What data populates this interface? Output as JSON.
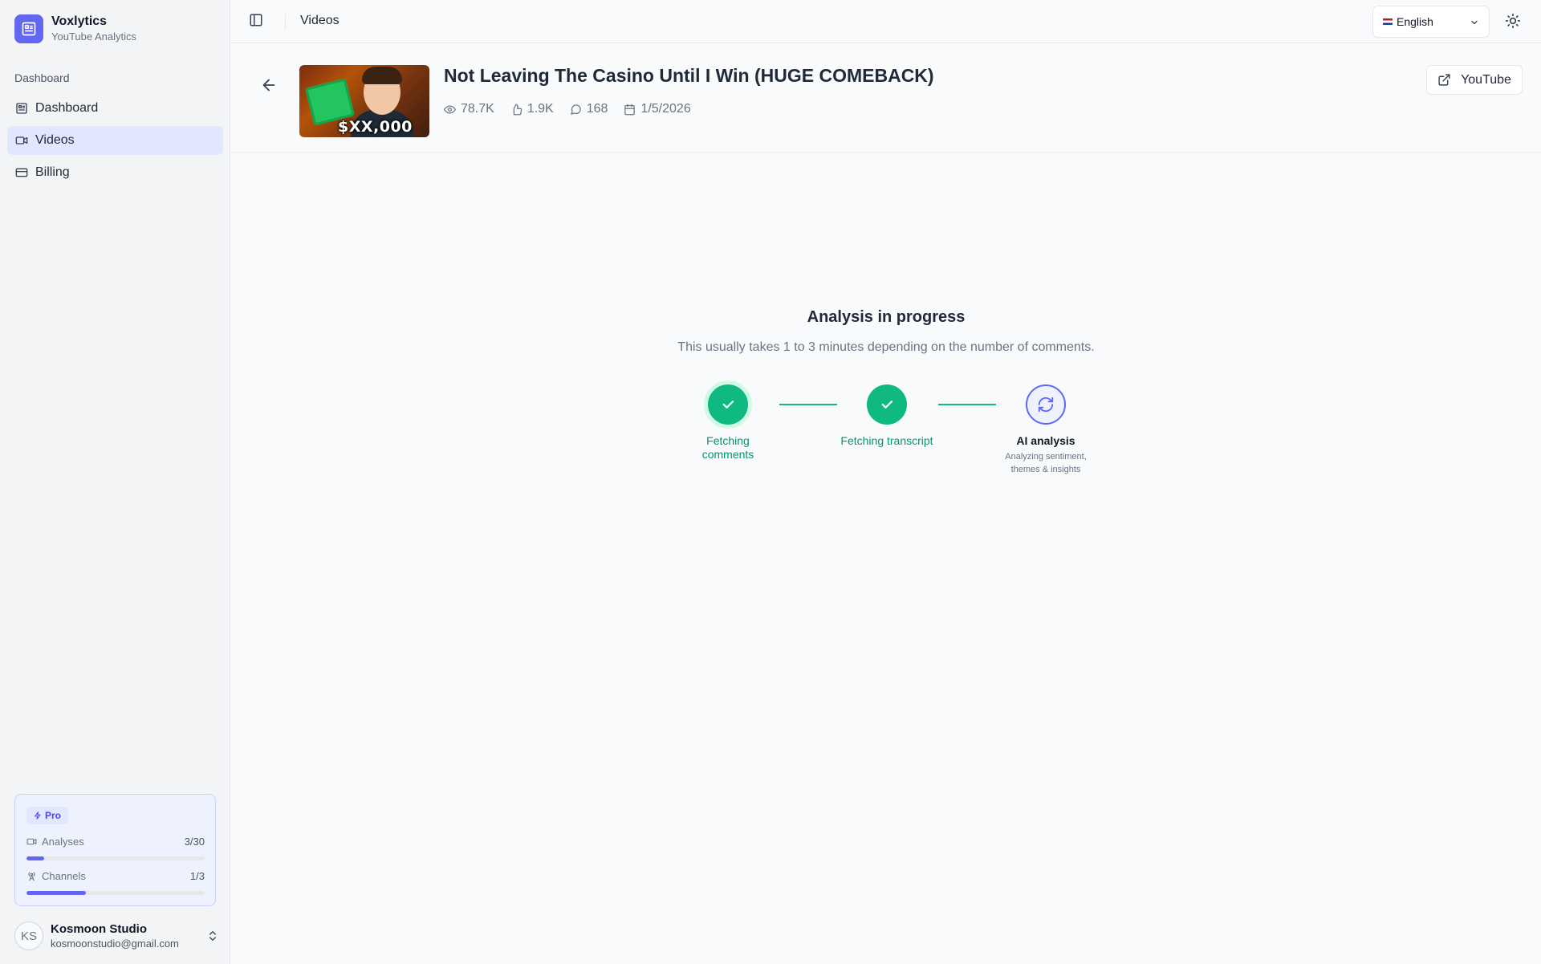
{
  "brand": {
    "name": "Voxlytics",
    "subtitle": "YouTube Analytics"
  },
  "sidebar": {
    "section_label": "Dashboard",
    "items": [
      {
        "label": "Dashboard",
        "icon": "dashboard-icon",
        "active": false
      },
      {
        "label": "Videos",
        "icon": "video-icon",
        "active": true
      },
      {
        "label": "Billing",
        "icon": "credit-card-icon",
        "active": false
      }
    ],
    "plan": {
      "badge": "Pro",
      "analyses": {
        "label": "Analyses",
        "count": "3/30",
        "fraction": 0.1
      },
      "channels": {
        "label": "Channels",
        "count": "1/3",
        "fraction": 0.333
      }
    },
    "user": {
      "initials": "KS",
      "name": "Kosmoon Studio",
      "email": "kosmoonstudio@gmail.com"
    }
  },
  "topbar": {
    "breadcrumb": "Videos",
    "language": "English"
  },
  "video": {
    "title": "Not Leaving The Casino Until I Win (HUGE COMEBACK)",
    "thumbnail_text": "$XX,000",
    "views": "78.7K",
    "likes": "1.9K",
    "comments": "168",
    "date": "1/5/2026",
    "youtube_label": "YouTube"
  },
  "analysis": {
    "title": "Analysis in progress",
    "subtitle": "This usually takes 1 to 3 minutes depending on the number of comments.",
    "steps": [
      {
        "label": "Fetching comments",
        "status": "done"
      },
      {
        "label": "Fetching transcript",
        "status": "done"
      },
      {
        "label": "AI analysis",
        "status": "active",
        "desc_line1": "Analyzing sentiment,",
        "desc_line2": "themes & insights"
      }
    ]
  },
  "colors": {
    "accent": "#6366f1",
    "success": "#10b981",
    "active_nav": "#e0e7ff"
  }
}
